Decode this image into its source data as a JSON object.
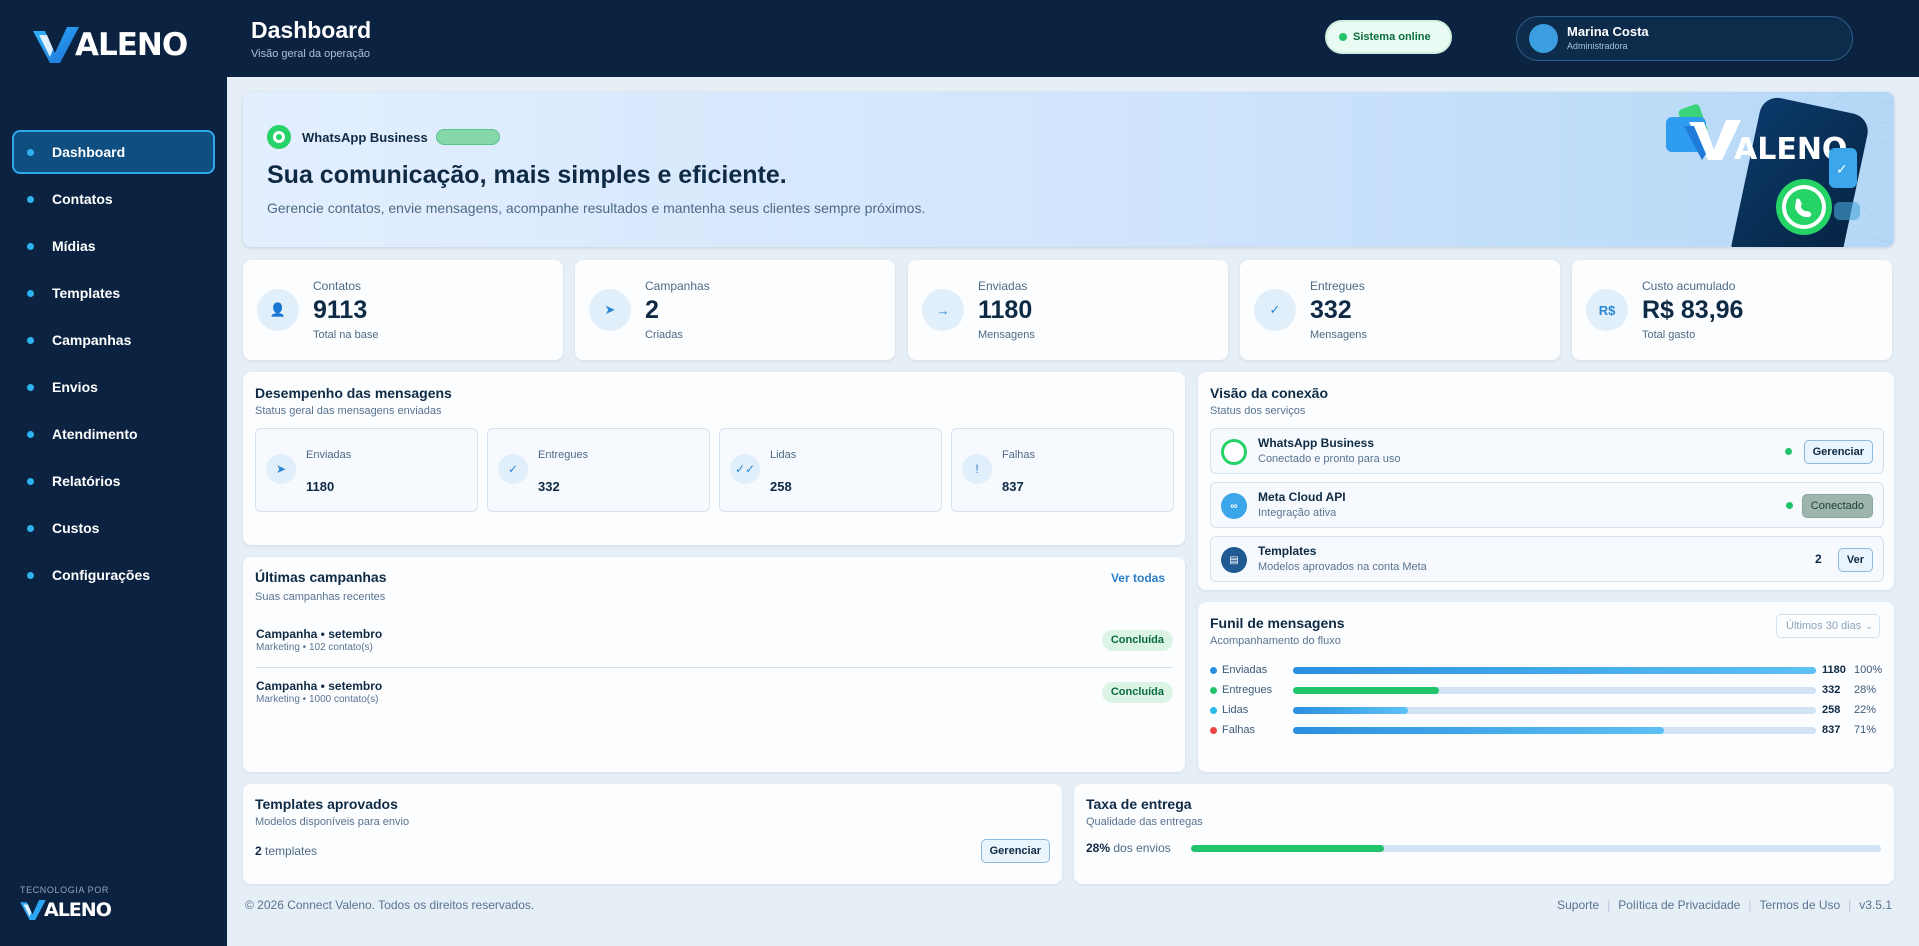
{
  "brand": {
    "name": "ALENO",
    "tech_label": "TECNOLOGIA POR"
  },
  "sidebar": {
    "items": [
      {
        "label": "Dashboard",
        "active": true
      },
      {
        "label": "Contatos"
      },
      {
        "label": "Mídias"
      },
      {
        "label": "Templates"
      },
      {
        "label": "Campanhas"
      },
      {
        "label": "Envios"
      },
      {
        "label": "Atendimento"
      },
      {
        "label": "Relatórios"
      },
      {
        "label": "Custos"
      },
      {
        "label": "Configurações"
      }
    ]
  },
  "header": {
    "title": "Dashboard",
    "subtitle": "Visão geral da operação",
    "status": "Sistema online",
    "user_name": "Marina Costa",
    "user_role": "Administradora"
  },
  "hero": {
    "channel": "WhatsApp Business",
    "title": "Sua comunicação, mais simples e eficiente.",
    "subtitle": "Gerencie contatos, envie mensagens, acompanhe resultados e mantenha seus clientes sempre próximos."
  },
  "stats": [
    {
      "label": "Contatos",
      "value": "9113",
      "sub": "Total na base",
      "icon": "user-icon",
      "glyph": "👤"
    },
    {
      "label": "Campanhas",
      "value": "2",
      "sub": "Criadas",
      "icon": "send-icon",
      "glyph": "➤"
    },
    {
      "label": "Enviadas",
      "value": "1180",
      "sub": "Mensagens",
      "icon": "arrow-icon",
      "glyph": "→"
    },
    {
      "label": "Entregues",
      "value": "332",
      "sub": "Mensagens",
      "icon": "check-icon",
      "glyph": "✓"
    },
    {
      "label": "Custo acumulado",
      "value": "R$ 83,96",
      "sub": "Total gasto",
      "icon": "currency-icon",
      "glyph": "R$"
    }
  ],
  "performance": {
    "title": "Desempenho das mensagens",
    "subtitle": "Status geral das mensagens enviadas",
    "items": [
      {
        "label": "Enviadas",
        "value": "1180",
        "glyph": "➤"
      },
      {
        "label": "Entregues",
        "value": "332",
        "glyph": "✓"
      },
      {
        "label": "Lidas",
        "value": "258",
        "glyph": "✓✓"
      },
      {
        "label": "Falhas",
        "value": "837",
        "glyph": "!"
      }
    ]
  },
  "campaigns": {
    "title": "Últimas campanhas",
    "subtitle": "Suas campanhas recentes",
    "link": "Ver todas",
    "rows": [
      {
        "name": "Campanha • setembro",
        "meta": "Marketing • 102 contato(s)",
        "status": "Concluída"
      },
      {
        "name": "Campanha • setembro",
        "meta": "Marketing • 1000 contato(s)",
        "status": "Concluída"
      }
    ]
  },
  "connection": {
    "title": "Visão da conexão",
    "subtitle": "Status dos serviços",
    "rows": [
      {
        "name": "WhatsApp Business",
        "sub": "Conectado e pronto para uso",
        "action": "Gerenciar",
        "color": "#25d366"
      },
      {
        "name": "Meta Cloud API",
        "sub": "Integração ativa",
        "action": "Conectado",
        "color": "#3ba6ea"
      },
      {
        "name": "Templates",
        "sub": "Modelos aprovados na conta Meta",
        "count": "2",
        "action": "Ver",
        "color": "#1f5a93"
      }
    ]
  },
  "funnel": {
    "title": "Funil de mensagens",
    "subtitle": "Acompanhamento do fluxo",
    "period": "Últimos 30 dias",
    "rows": [
      {
        "label": "Enviadas",
        "value": "1180",
        "pct": "100%",
        "fill": 1.0,
        "color": "#2b8fe0",
        "bar": "linear-gradient(90deg,#2b8fe0,#5cc1f4)"
      },
      {
        "label": "Entregues",
        "value": "332",
        "pct": "28%",
        "fill": 0.28,
        "color": "#21c46b",
        "bar": "#21c46b"
      },
      {
        "label": "Lidas",
        "value": "258",
        "pct": "22%",
        "fill": 0.22,
        "color": "#2bb9e8",
        "bar": "linear-gradient(90deg,#2b8fe0,#5cc1f4)"
      },
      {
        "label": "Falhas",
        "value": "837",
        "pct": "71%",
        "fill": 0.71,
        "color": "#ef4444",
        "bar": "linear-gradient(90deg,#2b8fe0,#5cc1f4)"
      }
    ]
  },
  "templates": {
    "title": "Templates aprovados",
    "subtitle": "Modelos disponíveis para envio",
    "count": "2",
    "count_label": "templates",
    "action": "Gerenciar"
  },
  "delivery": {
    "title": "Taxa de entrega",
    "subtitle": "Qualidade das entregas",
    "pct": "28%",
    "pct_label": "dos envios",
    "fill": 0.28
  },
  "footer": {
    "copyright": "© 2026 Connect Valeno. Todos os direitos reservados.",
    "links": [
      "Suporte",
      "Política de Privacidade",
      "Termos de Uso"
    ],
    "version": "v3.5.1"
  }
}
